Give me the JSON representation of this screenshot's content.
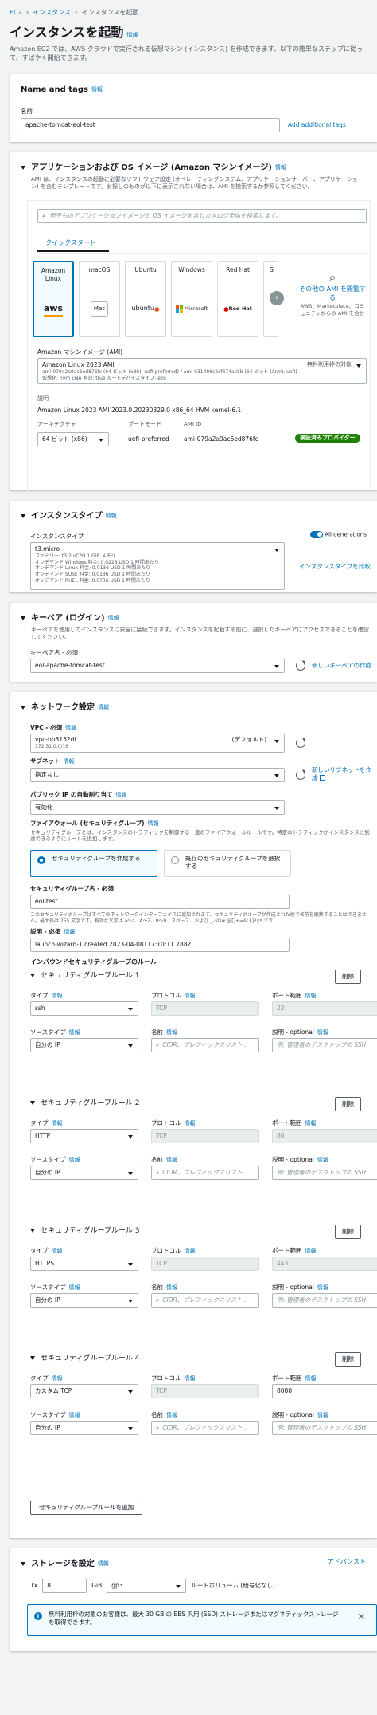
{
  "breadcrumb": [
    "EC2",
    "インスタンス",
    "インスタンスを起動"
  ],
  "page": {
    "title": "インスタンスを起動",
    "info": "情報",
    "description": "Amazon EC2 では、AWS クラウドで実行される仮想マシン (インスタンス) を作成できます。以下の簡単なステップに従って、すばやく開始できます。"
  },
  "name_tags": {
    "title": "Name and tags",
    "info": "情報",
    "name_label": "名前",
    "name_value": "apache-tomcat-eol-test",
    "add_tags": "Add additional tags"
  },
  "ami": {
    "title": "アプリケーションおよび OS イメージ (Amazon マシンイメージ)",
    "info": "情報",
    "desc": "AMI は、インスタンスの起動に必要なソフトウェア設定 (オペレーティングシステム、アプリケーションサーバー、アプリケーション) を含むテンプレートです。お探しのものが以下に表示されない場合は、AMI を検索するか参照してください。",
    "search_placeholder": "何千ものアプリケーションイメージと OS イメージを含むカタログ全体を検索します。",
    "tab": "クイックスタート",
    "tiles": [
      "Amazon Linux",
      "macOS",
      "Ubuntu",
      "Windows",
      "Red Hat",
      "S"
    ],
    "tile_logos": [
      "aws",
      "Mac",
      "ubuntu",
      "Microsoft",
      "Red Hat"
    ],
    "browse_more": "その他の AMI を閲覧する",
    "browse_sub": "AWS、Marketplace、コミュニティからの AMI を含む",
    "ami_label": "Amazon マシンイメージ (AMI)",
    "ami_name": "Amazon Linux 2023 AMI",
    "ami_detail": "ami-079a2a9ac6ed876fc (64 ビット (x86), uefi-preferred) / ami-031486c2cf674ac5b (64 ビット (Arm), uefi)",
    "ami_detail2": "仮想化: hvm   ENA 有効: true   ルートデバイスタイプ: ebs",
    "free_tier": "無料利用枠の対象",
    "desc_label": "説明",
    "desc_value": "Amazon Linux 2023 AMI 2023.0.20230329.0 x86_64 HVM kernel-6.1",
    "arch_label": "アーキテクチャ",
    "arch_value": "64 ビット (x86)",
    "boot_label": "ブートモード",
    "boot_value": "uefi-preferred",
    "amiid_label": "AMI ID",
    "amiid_value": "ami-079a2a9ac6ed876fc",
    "verified": "検証済みプロバイダー"
  },
  "instance_type": {
    "title": "インスタンスタイプ",
    "info": "情報",
    "label": "インスタンスタイプ",
    "all_gen": "All generations",
    "name": "t3.micro",
    "lines": [
      "ファミリー: t3    2 vCPU    1 GiB メモリ",
      "オンデマンド Windows 料金: 0.0228 USD 1 時間あたり",
      "オンデマンド Linux 料金: 0.0136 USD 1 時間あたり",
      "オンデマンド SUSE 料金: 0.0136 USD 1 時間あたり",
      "オンデマンド RHEL 料金: 0.0736 USD 1 時間あたり"
    ],
    "compare": "インスタンスタイプを比較"
  },
  "keypair": {
    "title": "キーペア (ログイン)",
    "info": "情報",
    "desc": "キーペアを使用してインスタンスに安全に接続できます。インスタンスを起動する前に、選択したキーペアにアクセスできることを確認してください。",
    "label": "キーペア名 - 必須",
    "value": "eol-apache-tomcat-test",
    "create": "新しいキーペアの作成"
  },
  "network": {
    "title": "ネットワーク設定",
    "info": "情報",
    "vpc_label": "VPC - 必須",
    "vpc_value": "vpc-bb3152df",
    "vpc_default": "(デフォルト)",
    "vpc_cidr": "172.31.0.0/16",
    "subnet_label": "サブネット",
    "subnet_value": "指定なし",
    "new_subnet": "新しいサブネットを作成",
    "public_ip_label": "パブリック IP の自動割り当て",
    "public_ip_value": "有効化",
    "fw_label": "ファイアウォール (セキュリティグループ)",
    "fw_desc": "セキュリティグループとは、インスタンスのトラフィックを制御する一連のファイアウォールルールです。特定のトラフィックがインスタンスに到達できるようにルールを追加します。",
    "sg_create": "セキュリティグループを作成する",
    "sg_existing": "既存のセキュリティグループを選択する",
    "sg_name_label": "セキュリティグループ名 - 必須",
    "sg_name_value": "eol-test",
    "sg_name_help": "このセキュリティグループはすべてのネットワークインターフェイスに追加されます。セキュリティグループが作成された後で名前を編集することはできません。最大長は 255 文字です。有効な文字は a～z、A～Z、0～9、スペース、および _-:/()#,@[]+=&;{}!$* です",
    "desc_label": "説明 - 必須",
    "desc_value": "launch-wizard-1 created 2023-04-08T17:10:11.788Z",
    "inbound_title": "インバウンドセキュリティグループのルール",
    "rules": [
      {
        "title": "セキュリティグループルール 1",
        "type": "ssh",
        "protocol": "TCP",
        "port": "22",
        "source": "自分の IP",
        "port_disabled": true
      },
      {
        "title": "セキュリティグループルール 2",
        "type": "HTTP",
        "protocol": "TCP",
        "port": "80",
        "source": "自分の IP",
        "port_disabled": true
      },
      {
        "title": "セキュリティグループルール 3",
        "type": "HTTPS",
        "protocol": "TCP",
        "port": "443",
        "source": "自分の IP",
        "port_disabled": true
      },
      {
        "title": "セキュリティグループルール 4",
        "type": "カスタム TCP",
        "protocol": "TCP",
        "port": "8080",
        "source": "自分の IP",
        "port_disabled": false
      }
    ],
    "labels": {
      "type": "タイプ",
      "protocol": "プロトコル",
      "port": "ポート範囲",
      "source_type": "ソースタイプ",
      "name": "名前",
      "desc": "説明 - optional",
      "info": "情報",
      "remove": "削除",
      "cidr_placeholder": "CIDR、プレフィックスリスト...",
      "desc_placeholder": "例: 管理者のデスクトップの SSH"
    },
    "add_rule": "セキュリティグループルールを追加"
  },
  "storage": {
    "title": "ストレージを設定",
    "info": "情報",
    "advanced": "アドバンスト",
    "count": "1x",
    "size": "8",
    "unit": "GiB",
    "volume_type": "gp3",
    "root_label": "ルートボリューム (暗号化なし)",
    "alert": "無料利用枠の対象のお客様は、最大 30 GB の EBS 汎用 (SSD) ストレージまたはマグネティックストレージを取得できます。"
  }
}
